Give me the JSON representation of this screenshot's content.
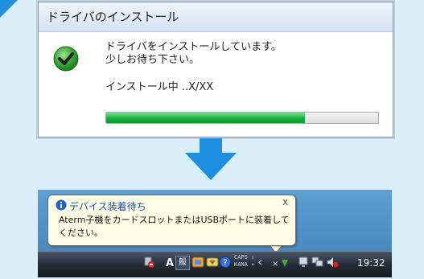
{
  "dialog": {
    "title": "ドライバのインストール",
    "message_line1": "ドライバをインストールしています。",
    "message_line2": "少しお待ち下さい。",
    "progress_label": "インストール中 ..X/XX",
    "progress": 0.73
  },
  "notification": {
    "title": "デバイス装着待ち",
    "text": "Aterm子機をカードスロットまたはUSBポートに装着してください。",
    "close": "x"
  },
  "taskbar": {
    "ime_mode": "A",
    "ime_kanji": "般",
    "caps": "CAPS",
    "kana": "KANA",
    "caps_arrow": "⇧",
    "kana_arrow": "▾",
    "expand_arrow": "‹",
    "clock": "19:32"
  },
  "colors": {
    "background": "#d9eef7",
    "accent": "#1e8fe0",
    "progress_green": "#19b03d",
    "checkmark_green": "#2f9a2f",
    "taskbar": "#262d38"
  },
  "icons": [
    "check-circle-icon",
    "down-arrow-icon",
    "info-icon",
    "network-icon",
    "volume-icon"
  ]
}
